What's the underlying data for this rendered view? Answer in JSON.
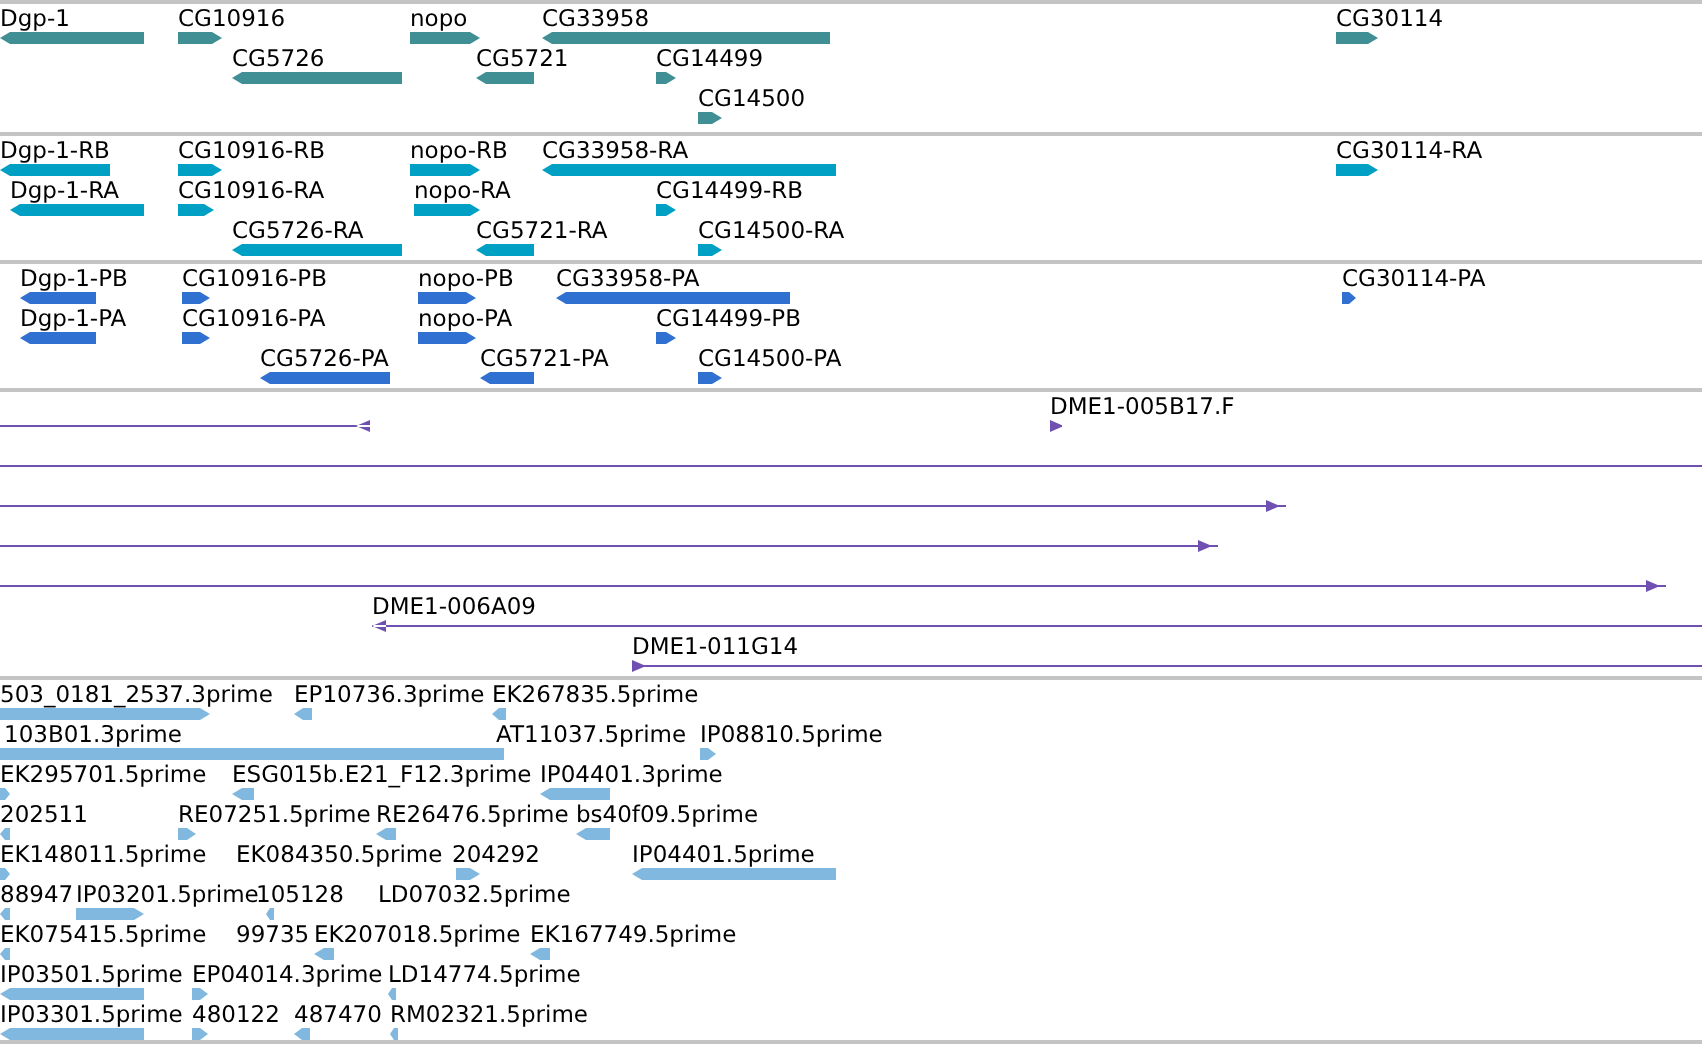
{
  "tracks": [
    {
      "kind": "block",
      "color": "#3f8f94",
      "features": [
        {
          "label": "Dgp-1"
        },
        {
          "label": "CG10916"
        },
        {
          "label": "nopo"
        },
        {
          "label": "CG33958"
        },
        {
          "label": "CG30114"
        },
        {
          "label": "CG5726"
        },
        {
          "label": "CG5721"
        },
        {
          "label": "CG14499"
        },
        {
          "label": "CG14500"
        }
      ]
    },
    {
      "kind": "block",
      "color": "#00a0c4",
      "features": [
        {
          "label": "Dgp-1-RB"
        },
        {
          "label": "CG10916-RB"
        },
        {
          "label": "nopo-RB"
        },
        {
          "label": "CG33958-RA"
        },
        {
          "label": "CG30114-RA"
        },
        {
          "label": "Dgp-1-RA"
        },
        {
          "label": "CG10916-RA"
        },
        {
          "label": "nopo-RA"
        },
        {
          "label": "CG14499-RB"
        },
        {
          "label": "CG5726-RA"
        },
        {
          "label": "CG5721-RA"
        },
        {
          "label": "CG14500-RA"
        }
      ]
    },
    {
      "kind": "block",
      "color": "#3070d0",
      "features": [
        {
          "label": "Dgp-1-PB"
        },
        {
          "label": "CG10916-PB"
        },
        {
          "label": "nopo-PB"
        },
        {
          "label": "CG33958-PA"
        },
        {
          "label": "CG30114-PA"
        },
        {
          "label": "Dgp-1-PA"
        },
        {
          "label": "CG10916-PA"
        },
        {
          "label": "nopo-PA"
        },
        {
          "label": "CG14499-PB"
        },
        {
          "label": "CG5726-PA"
        },
        {
          "label": "CG5721-PA"
        },
        {
          "label": "CG14500-PA"
        }
      ]
    },
    {
      "kind": "line",
      "color": "#7050b0",
      "features": [
        {
          "label": "DME1-005B17.F"
        },
        {
          "label": "DME1-006A09"
        },
        {
          "label": "DME1-011G14"
        }
      ]
    },
    {
      "kind": "block",
      "color": "#80b8e0",
      "features": [
        {
          "label": "503_0181_2537.3prime"
        },
        {
          "label": "EP10736.3prime"
        },
        {
          "label": "EK267835.5prime"
        },
        {
          "label": "103B01.3prime"
        },
        {
          "label": "AT11037.5prime"
        },
        {
          "label": "IP08810.5prime"
        },
        {
          "label": "EK295701.5prime"
        },
        {
          "label": "ESG015b.E21_F12.3prime"
        },
        {
          "label": "IP04401.3prime"
        },
        {
          "label": "202511"
        },
        {
          "label": "RE07251.5prime"
        },
        {
          "label": "RE26476.5prime"
        },
        {
          "label": "bs40f09.5prime"
        },
        {
          "label": "EK148011.5prime"
        },
        {
          "label": "EK084350.5prime"
        },
        {
          "label": "204292"
        },
        {
          "label": "IP04401.5prime"
        },
        {
          "label": "88947"
        },
        {
          "label": "IP03201.5prime"
        },
        {
          "label": "105128"
        },
        {
          "label": "LD07032.5prime"
        },
        {
          "label": "EK075415.5prime"
        },
        {
          "label": "99735"
        },
        {
          "label": "EK207018.5prime"
        },
        {
          "label": "EK167749.5prime"
        },
        {
          "label": "IP03501.5prime"
        },
        {
          "label": "EP04014.3prime"
        },
        {
          "label": "LD14774.5prime"
        },
        {
          "label": "IP03301.5prime"
        },
        {
          "label": "480122"
        },
        {
          "label": "487470"
        },
        {
          "label": "RM02321.5prime"
        }
      ]
    }
  ]
}
